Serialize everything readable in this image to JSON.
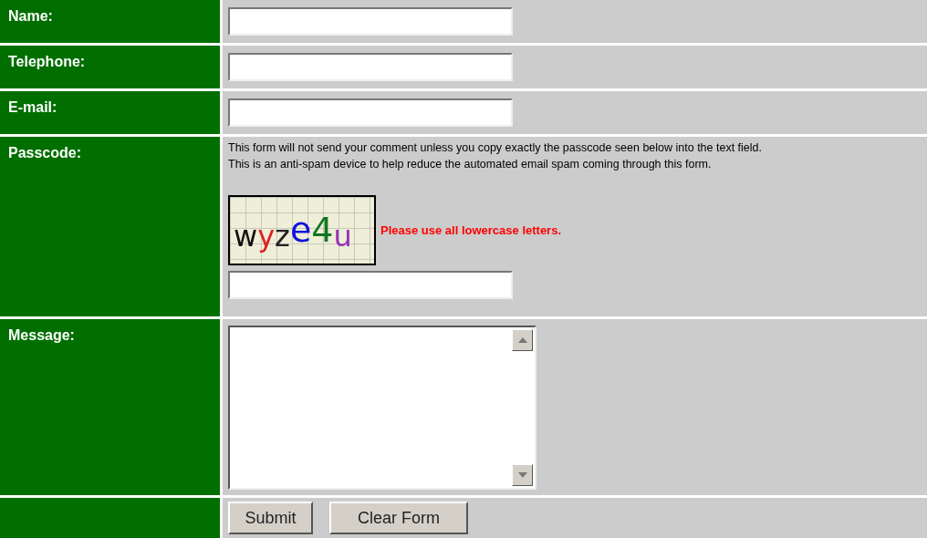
{
  "rows": [
    {
      "kind": "text",
      "label": "Name:"
    },
    {
      "kind": "text",
      "label": "Telephone:"
    },
    {
      "kind": "text",
      "label": "E-mail:"
    },
    {
      "kind": "passcode",
      "label": "Passcode:",
      "note": [
        "This form will not send your comment unless you copy exactly the passcode seen below into the text field.",
        "This is an anti-spam device to help reduce the automated email spam coming through this form."
      ],
      "captcha": [
        {
          "char": "w",
          "color": "#111111"
        },
        {
          "char": "y",
          "color": "#dd2222"
        },
        {
          "char": "z",
          "color": "#222222"
        },
        {
          "char": "e",
          "color": "#1111dd"
        },
        {
          "char": "4",
          "color": "#117722"
        },
        {
          "char": "u",
          "color": "#9933bb"
        }
      ],
      "hint": "Please use all lowercase letters."
    },
    {
      "kind": "textarea",
      "label": "Message:"
    },
    {
      "kind": "buttons",
      "buttons": [
        "Submit",
        "Clear Form"
      ]
    }
  ]
}
